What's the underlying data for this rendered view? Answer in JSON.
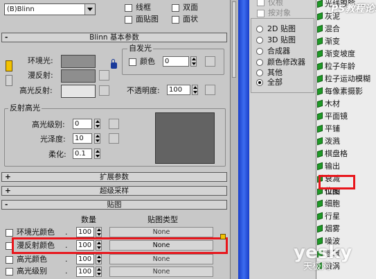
{
  "shader": {
    "selected": "(B)Blinn",
    "options": [
      {
        "label": "线框",
        "checked": false
      },
      {
        "label": "双面",
        "checked": false
      },
      {
        "label": "面贴图",
        "checked": false
      },
      {
        "label": "面状",
        "checked": false
      }
    ]
  },
  "blinn_basic": {
    "title": "Blinn 基本参数",
    "ambient_label": "环境光:",
    "diffuse_label": "漫反射:",
    "specular_label": "高光反射:",
    "self_illum_group": "自发光",
    "color_label": "颜色",
    "color_value": "0",
    "opacity_label": "不透明度:",
    "opacity_value": "100",
    "ambient_color": "#8e8e8e",
    "diffuse_color": "#8e8e8e",
    "specular_color": "#e6e6e6"
  },
  "spec_highlights": {
    "title": "反射高光",
    "level_label": "高光级别:",
    "level_value": "0",
    "gloss_label": "光泽度:",
    "gloss_value": "10",
    "soften_label": "柔化:",
    "soften_value": "0.1",
    "preview_color": "#636363"
  },
  "rollouts": {
    "extended": {
      "sign": "+",
      "title": "扩展参数"
    },
    "supersampling": {
      "sign": "+",
      "title": "超级采样"
    },
    "maps": {
      "sign": "-",
      "title": "贴图"
    }
  },
  "maps_table": {
    "col_amount": "数量",
    "col_map_type": "贴图类型",
    "rows": [
      {
        "label": "环境光颜色",
        "amount": "100",
        "map": "None"
      },
      {
        "label": "漫反射颜色",
        "amount": "100",
        "map": "None"
      },
      {
        "label": "高光颜色",
        "amount": "100",
        "map": "None"
      },
      {
        "label": "高光级别",
        "amount": "100",
        "map": "None"
      }
    ]
  },
  "browser_filter": {
    "top_items": [
      {
        "label": "仅根",
        "enabled": false
      },
      {
        "label": "按对象",
        "enabled": false
      }
    ],
    "radios": [
      {
        "label": "2D 贴图",
        "selected": false
      },
      {
        "label": "3D 贴图",
        "selected": false
      },
      {
        "label": "合成器",
        "selected": false
      },
      {
        "label": "颜色修改器",
        "selected": false
      },
      {
        "label": "其他",
        "selected": false
      },
      {
        "label": "全部",
        "selected": true
      }
    ]
  },
  "map_list": [
    "光线跟踪",
    "灰泥",
    "混合",
    "渐变",
    "渐变坡度",
    "粒子年龄",
    "粒子运动模糊",
    "每像素摄影",
    "木材",
    "平面镜",
    "平铺",
    "泼溅",
    "棋盘格",
    "输出",
    "衰减",
    "位图",
    "细胞",
    "行星",
    "烟雾",
    "噪波",
    "遮罩",
    "漩涡"
  ],
  "highlighted_map": "位图",
  "watermark_top": "PS教程论坛",
  "watermark_bottom": "天极网",
  "watermark_brand": "yesky"
}
